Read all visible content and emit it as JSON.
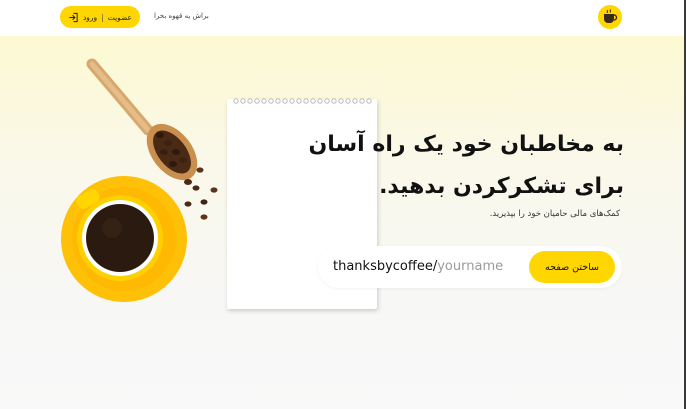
{
  "header": {
    "buy_link": "براش یه قهوه بخرا",
    "auth": {
      "signup": "عضویت",
      "separator": "|",
      "login": "ورود"
    },
    "logo_icon": "coffee-cup-logo-icon",
    "login_icon": "login-arrow-icon"
  },
  "hero": {
    "headline_line1": "به مخاطبان خود یک راه آسان",
    "headline_line2": "برای تشکرکردن بدهید.",
    "subtitle": "کمک‌های مالی حامیان خود را بپذیرید.",
    "url_prefix": "thanksbycoffee/",
    "url_placeholder": "yourname",
    "cta_label": "ساختن صفحه"
  },
  "colors": {
    "accent": "#ffd600",
    "hero_top": "#fdf9d2",
    "text": "#111111"
  }
}
